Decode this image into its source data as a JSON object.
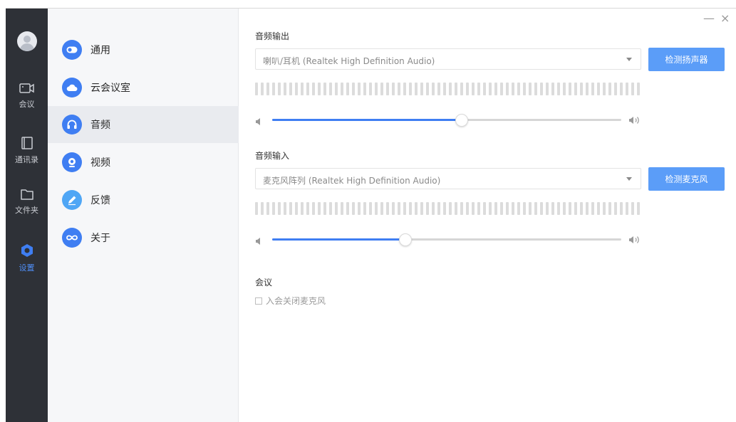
{
  "window": {
    "minimize": "—",
    "close": "×"
  },
  "rail": {
    "items": [
      {
        "label": "会议",
        "icon": "camera-icon"
      },
      {
        "label": "通讯录",
        "icon": "contacts-icon"
      },
      {
        "label": "文件夹",
        "icon": "folder-icon"
      },
      {
        "label": "设置",
        "icon": "settings-icon",
        "active": true
      }
    ]
  },
  "sidebar": {
    "items": [
      {
        "label": "通用",
        "icon": "toggle-icon"
      },
      {
        "label": "云会议室",
        "icon": "cloud-icon"
      },
      {
        "label": "音频",
        "icon": "headphones-icon",
        "active": true
      },
      {
        "label": "视频",
        "icon": "webcam-icon"
      },
      {
        "label": "反馈",
        "icon": "pencil-icon"
      },
      {
        "label": "关于",
        "icon": "infinity-icon"
      }
    ]
  },
  "audio_output": {
    "title": "音频输出",
    "device": "喇叭/耳机 (Realtek High Definition Audio)",
    "test_button": "检测扬声器",
    "volume": 0.54
  },
  "audio_input": {
    "title": "音频输入",
    "device": "麦克风阵列 (Realtek High Definition Audio)",
    "test_button": "检测麦克风",
    "volume": 0.38
  },
  "meeting": {
    "title": "会议",
    "mute_on_join_label": "入会关闭麦克风",
    "mute_on_join": false
  },
  "colors": {
    "accent": "#3f7ef2",
    "button": "#5b9df8",
    "rail": "#2e3137"
  }
}
